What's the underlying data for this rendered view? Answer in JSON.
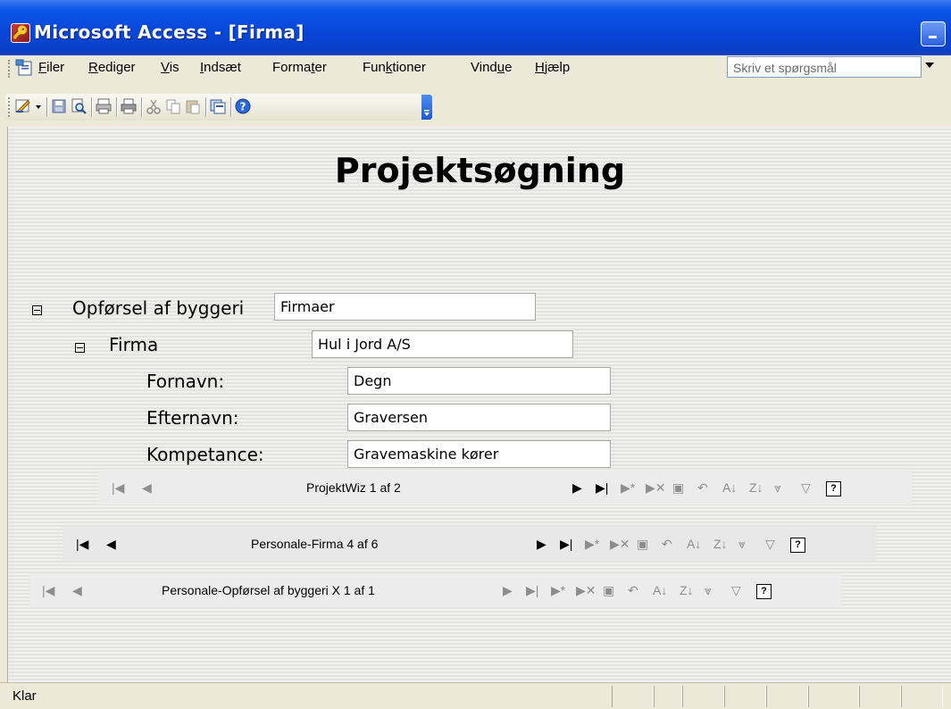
{
  "window": {
    "title": "Microsoft Access - [Firma]",
    "app_icon": "access-key-icon"
  },
  "menu": {
    "items": [
      "Filer",
      "Rediger",
      "Vis",
      "Indsæt",
      "Formater",
      "Funktioner",
      "Vindue",
      "Hjælp"
    ],
    "mnemonics": [
      "F",
      "R",
      "V",
      "I",
      "t",
      "k",
      "u",
      "H"
    ],
    "ask_placeholder": "Skriv et spørgsmål"
  },
  "toolbar": {
    "buttons": [
      "design-view-icon",
      "save-icon",
      "search-icon",
      "print-preview-icon",
      "print-icon",
      "cut-icon",
      "copy-icon",
      "paste-icon",
      "new-object-icon",
      "help-icon"
    ]
  },
  "form": {
    "title": "Projektsøgning",
    "group": {
      "label": "Opførsel af byggeri",
      "value": "Firmaer"
    },
    "firm": {
      "label": "Firma",
      "value": "Hul i Jord A/S"
    },
    "fields": [
      {
        "label": "Fornavn:",
        "value": "Degn"
      },
      {
        "label": "Efternavn:",
        "value": "Graversen"
      },
      {
        "label": "Kompetance:",
        "value": "Gravemaskine kører"
      }
    ]
  },
  "navigators": [
    {
      "record_text": "ProjektWiz 1 af 2"
    },
    {
      "record_text": "Personale-Firma 4 af 6"
    },
    {
      "record_text": "Personale-Opførsel af byggeri X 1 af 1"
    }
  ],
  "status": {
    "text": "Klar"
  },
  "colors": {
    "titlebar": "#0a55e8",
    "menubar": "#ece9d8",
    "workspace": "#e8e8e6"
  }
}
